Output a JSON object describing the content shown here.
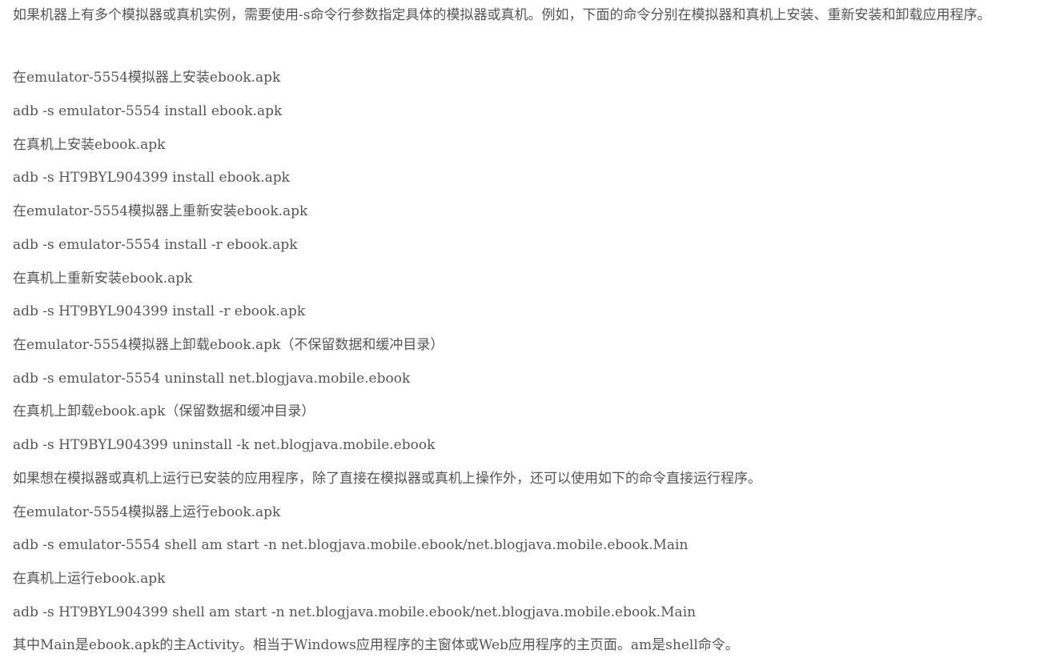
{
  "article": {
    "intro": "如果机器上有多个模拟器或真机实例，需要使用-s命令行参数指定具体的模拟器或真机。例如，下面的命令分别在模拟器和真机上安装、重新安装和卸载应用程序。",
    "lines": [
      "在emulator-5554模拟器上安装ebook.apk",
      "adb -s emulator-5554 install ebook.apk",
      "在真机上安装ebook.apk",
      "adb -s HT9BYL904399 install ebook.apk",
      "在emulator-5554模拟器上重新安装ebook.apk",
      "adb -s emulator-5554 install -r ebook.apk",
      "在真机上重新安装ebook.apk",
      "adb -s HT9BYL904399 install -r ebook.apk",
      "在emulator-5554模拟器上卸载ebook.apk（不保留数据和缓冲目录）",
      "adb -s emulator-5554 uninstall net.blogjava.mobile.ebook",
      "在真机上卸载ebook.apk（保留数据和缓冲目录）",
      "adb -s HT9BYL904399 uninstall -k net.blogjava.mobile.ebook",
      "如果想在模拟器或真机上运行已安装的应用程序，除了直接在模拟器或真机上操作外，还可以使用如下的命令直接运行程序。",
      "在emulator-5554模拟器上运行ebook.apk",
      "adb -s emulator-5554 shell am start -n net.blogjava.mobile.ebook/net.blogjava.mobile.ebook.Main",
      "在真机上运行ebook.apk",
      "adb -s HT9BYL904399 shell am start -n net.blogjava.mobile.ebook/net.blogjava.mobile.ebook.Main",
      "其中Main是ebook.apk的主Activity。相当于Windows应用程序的主窗体或Web应用程序的主页面。am是shell命令。"
    ]
  }
}
